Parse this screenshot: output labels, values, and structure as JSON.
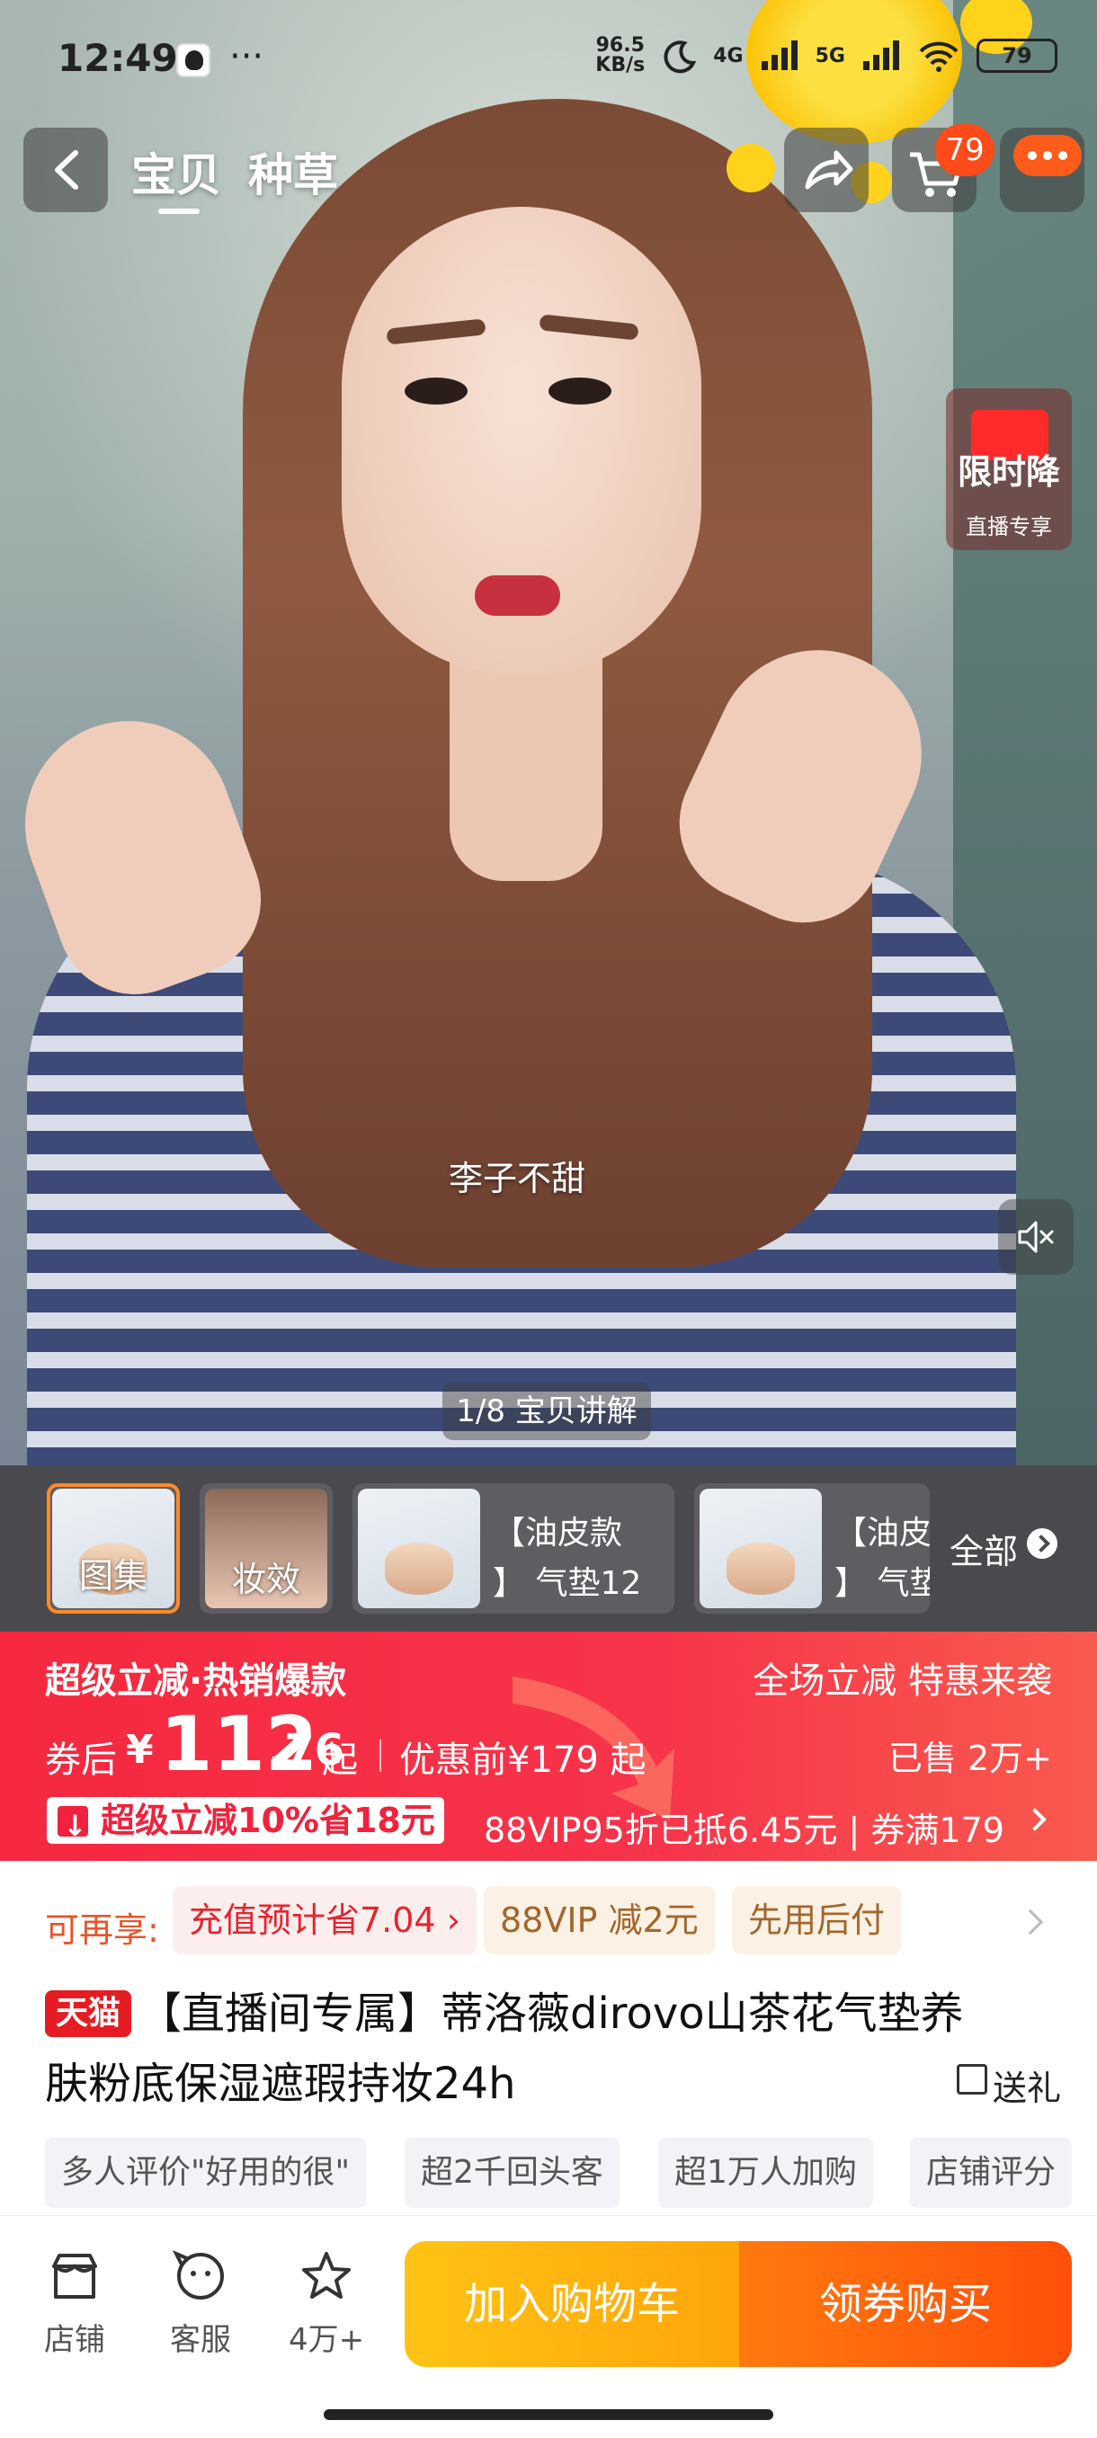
{
  "status_bar": {
    "time": "12:49",
    "dots": "···",
    "net_speed_value": "96.5",
    "net_speed_unit": "KB/s",
    "signal_1": "4G",
    "signal_2": "5G",
    "battery": "79"
  },
  "header": {
    "tabs": [
      {
        "label": "宝贝"
      },
      {
        "label": "种草"
      }
    ],
    "cart_badge": "79"
  },
  "video": {
    "limited_title": "限时降",
    "limited_sub": "直播专享",
    "caption": "李子不甜",
    "progress": "1/8 宝贝讲解"
  },
  "thumbnails": {
    "items": [
      {
        "label": "图集"
      },
      {
        "label": "妆效"
      },
      {
        "text": "【油皮款\n】 气垫12"
      },
      {
        "text": "【油皮\n】 气垫"
      }
    ],
    "all_label": "全部"
  },
  "promo": {
    "title": "超级立减·热销爆款",
    "right_text": "全场立减 特惠来袭",
    "price_label": "券后",
    "currency": "¥",
    "price_int": "112",
    "price_dec": ".76",
    "price_suffix": "起",
    "price_before": "优惠前¥179 起",
    "sold": "已售 2万+",
    "coupon_tag": "超级立减10%省18元",
    "vip_text": "88VIP95折已抵6.45元 | 券满179"
  },
  "benefits": {
    "label": "可再享:",
    "chips": [
      "充值预计省7.04 ›",
      "88VIP 减2元",
      "先用后付"
    ]
  },
  "product": {
    "badge": "天猫",
    "title_line1": "【直播间专属】蒂洛薇dirovo山茶花气垫养",
    "title_line2": "肤粉底保湿遮瑕持妆24h",
    "gift": "送礼"
  },
  "tags": [
    "多人评价\"好用的很\"",
    "超2千回头客",
    "超1万人加购",
    "店铺评分"
  ],
  "bottom_bar": {
    "store": "店铺",
    "service": "客服",
    "favorites": "4万+",
    "add_cart": "加入购物车",
    "buy": "领券购买"
  }
}
